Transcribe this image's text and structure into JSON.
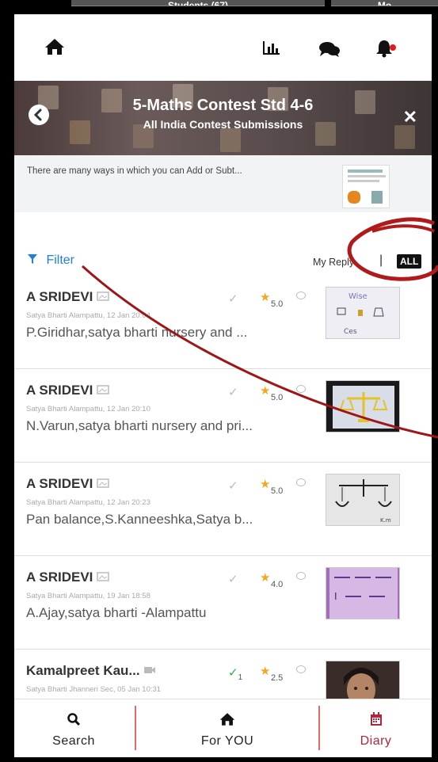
{
  "top_tabs": [
    "Students (67)",
    "Mo"
  ],
  "header": {
    "icons": [
      "home-icon",
      "chart-icon",
      "chat-icon",
      "bell-icon"
    ]
  },
  "banner": {
    "title": "5-Maths Contest Std 4-6",
    "subtitle": "All India Contest Submissions"
  },
  "description": {
    "text": "There are many ways in which you can Add or Subt..."
  },
  "filter": {
    "label": "Filter",
    "my_reply": "My Reply",
    "separator": "|",
    "all_label": "ALL"
  },
  "items": [
    {
      "name": "A SRIDEVI",
      "meta": "Satya Bharti Alampattu, 12 Jan 20:04",
      "title": "P.Giridhar,satya bharti nursery and ...",
      "rating": "5.0",
      "check_count": "",
      "media": "image"
    },
    {
      "name": "A SRIDEVI",
      "meta": "Satya Bharti Alampattu, 12 Jan 20:10",
      "title": "N.Varun,satya bharti nursery and pri...",
      "rating": "5.0",
      "check_count": "",
      "media": "image"
    },
    {
      "name": "A SRIDEVI",
      "meta": "Satya Bharti Alampattu, 12 Jan 20:23",
      "title": "Pan balance,S.Kanneeshka,Satya b...",
      "rating": "5.0",
      "check_count": "",
      "media": "image"
    },
    {
      "name": "A SRIDEVI",
      "meta": "Satya Bharti Alampattu, 19 Jan 18:58",
      "title": "A.Ajay,satya bharti -Alampattu",
      "rating": "4.0",
      "check_count": "",
      "media": "image"
    },
    {
      "name": "Kamalpreet Kau...",
      "meta": "Satya Bharti Jhanneri Sec, 05 Jan 10:31",
      "title": "",
      "rating": "2.5",
      "check_count": "1",
      "media": "video"
    }
  ],
  "bottom_nav": [
    {
      "label": "Search",
      "icon": "search-icon"
    },
    {
      "label": "For YOU",
      "icon": "home-icon"
    },
    {
      "label": "Diary",
      "icon": "calendar-icon"
    }
  ],
  "colors": {
    "accent": "#1e7fe0",
    "diary": "#b0253a",
    "star": "#f5a623",
    "annotation": "#b11a1a"
  }
}
